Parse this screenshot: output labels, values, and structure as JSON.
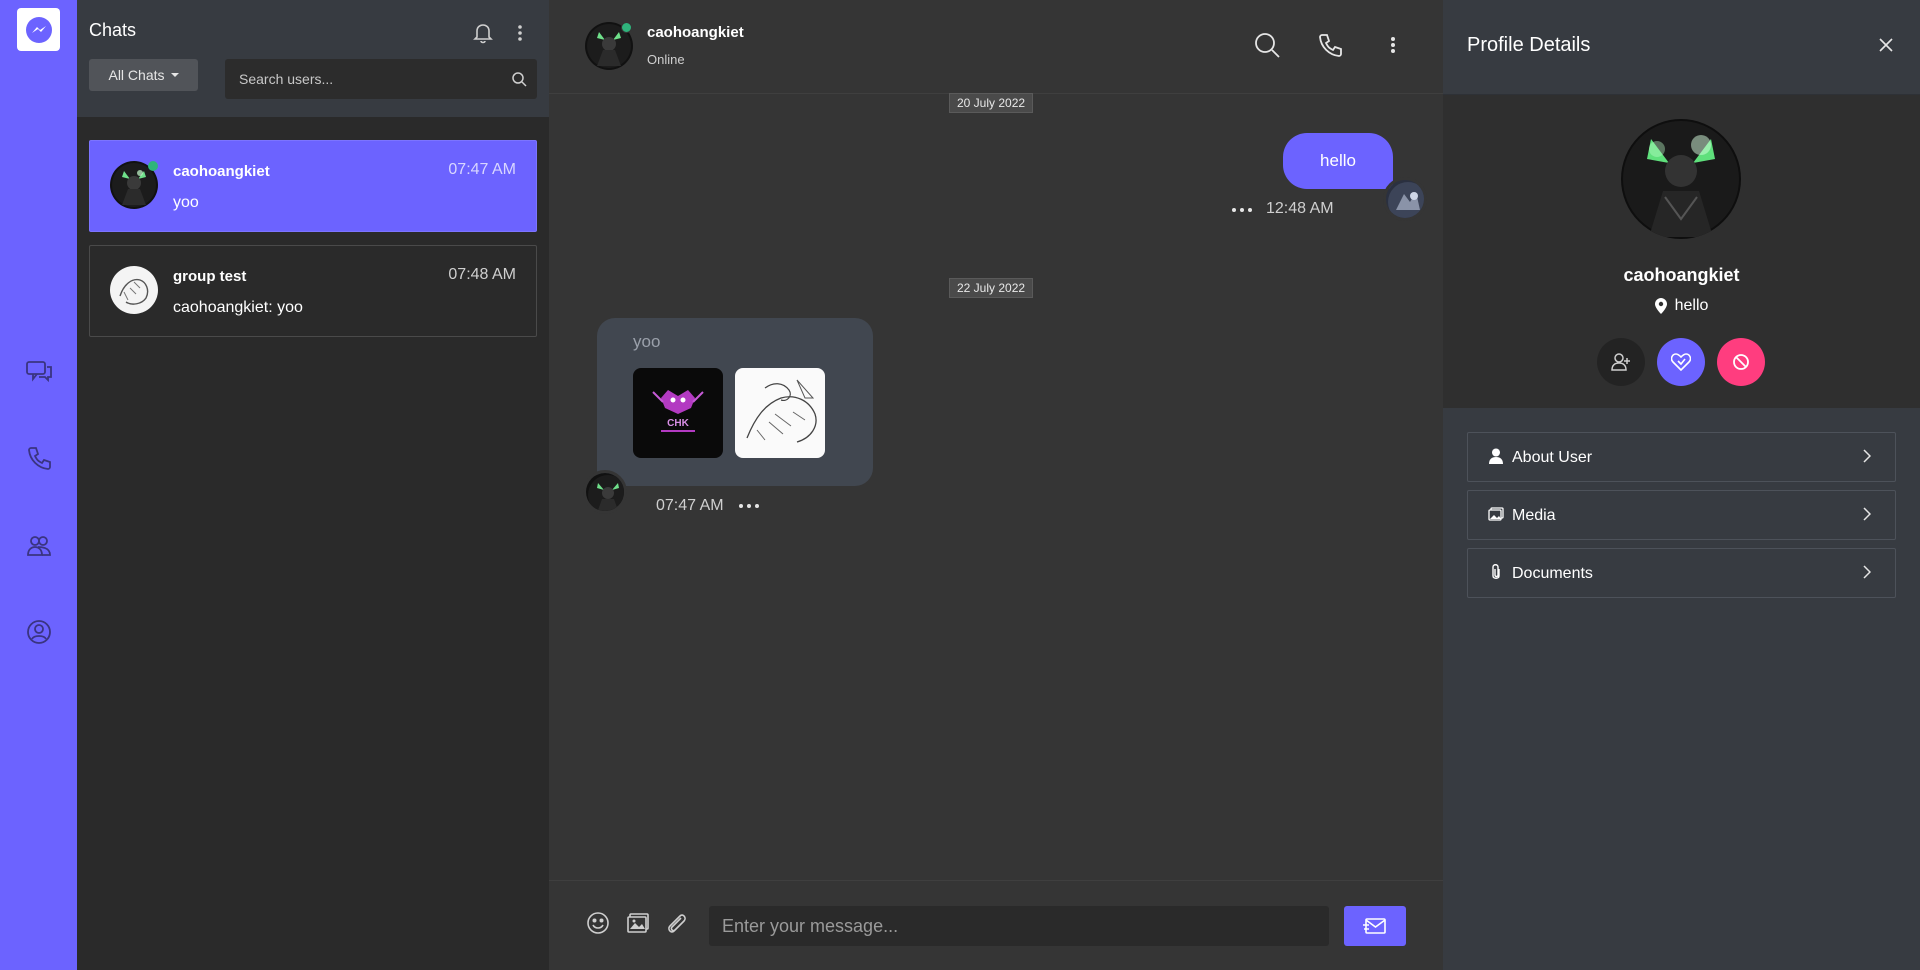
{
  "colors": {
    "accent": "#6c63ff",
    "online": "#2fb47c",
    "danger": "#ff3d7f"
  },
  "rail": {
    "icons": [
      "messenger-logo-icon",
      "chats-icon",
      "calls-icon",
      "contacts-icon",
      "profile-icon"
    ]
  },
  "chat_list": {
    "title": "Chats",
    "filter_label": "All Chats",
    "search_placeholder": "Search users...",
    "items": [
      {
        "name": "caohoangkiet",
        "time": "07:47 AM",
        "preview": "yoo",
        "active": true,
        "online": true
      },
      {
        "name": "group test",
        "time": "07:48 AM",
        "preview": "caohoangkiet: yoo",
        "active": false,
        "online": false
      }
    ]
  },
  "conversation": {
    "name": "caohoangkiet",
    "status": "Online",
    "dates": [
      "20 July 2022",
      "22 July 2022"
    ],
    "messages": [
      {
        "direction": "out",
        "text": "hello",
        "time": "12:48 AM"
      },
      {
        "direction": "in",
        "text": "yoo",
        "time": "07:47 AM",
        "attachments": 2
      }
    ],
    "composer_placeholder": "Enter your message..."
  },
  "profile": {
    "title": "Profile Details",
    "name": "caohoangkiet",
    "location": "hello",
    "sections": [
      "About User",
      "Media",
      "Documents"
    ]
  }
}
